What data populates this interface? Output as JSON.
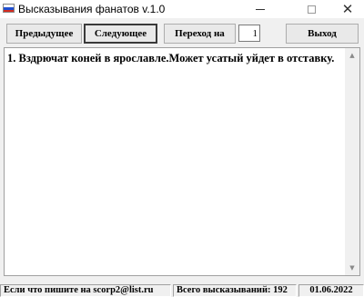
{
  "window": {
    "title": "Высказывания фанатов v.1.0",
    "icon": "russian-flag-icon"
  },
  "toolbar": {
    "prev_label": "Предыдущее",
    "next_label": "Следующее",
    "goto_label": "Переход на",
    "goto_value": "1",
    "exit_label": "Выход"
  },
  "content": {
    "quote": "1. Вздрючат коней в ярославле.Может усатый уйдет в отставку."
  },
  "status": {
    "email_text": "Если что пишите на scorp2@list.ru",
    "count_text": "Всего высказываний: 192",
    "date_text": "01.06.2022"
  }
}
